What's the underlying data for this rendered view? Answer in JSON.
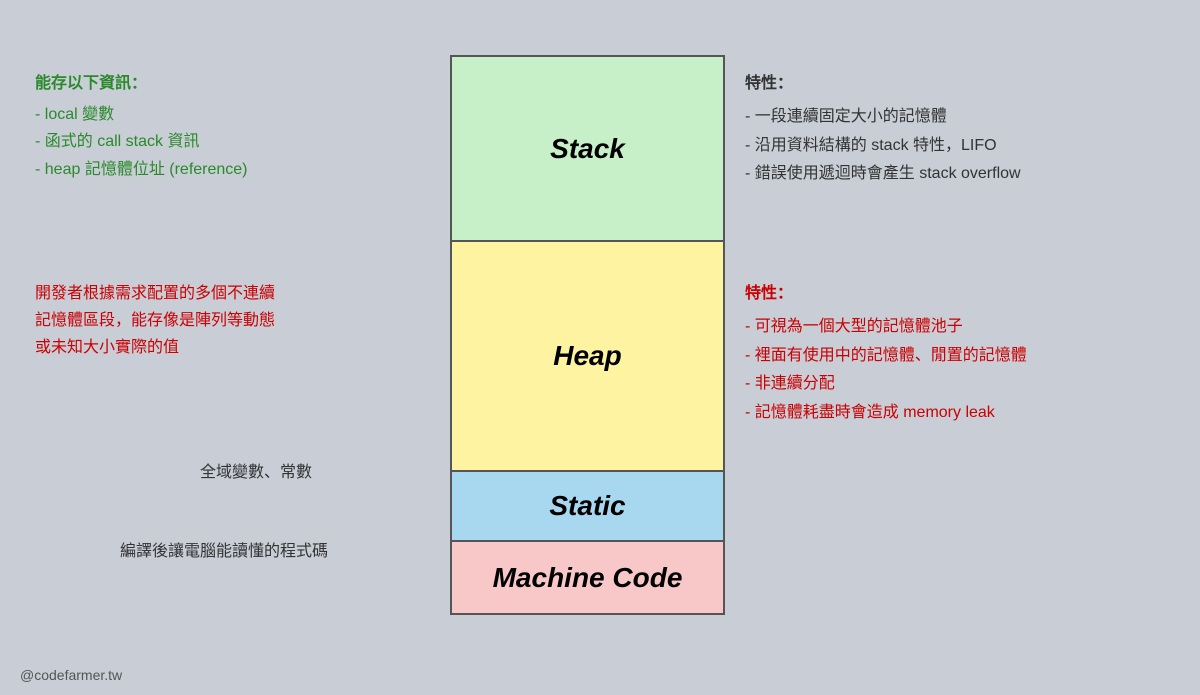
{
  "diagram": {
    "blocks": [
      {
        "id": "stack",
        "label": "Stack",
        "color_bg": "#c8f0c8"
      },
      {
        "id": "heap",
        "label": "Heap",
        "color_bg": "#fdf3a0"
      },
      {
        "id": "static",
        "label": "Static",
        "color_bg": "#a8d8f0"
      },
      {
        "id": "machine",
        "label": "Machine Code",
        "color_bg": "#f8c8c8"
      }
    ]
  },
  "left_stack": {
    "title": "能存以下資訊：",
    "lines": [
      "- local 變數",
      "- 函式的 call stack 資訊",
      "- heap 記憶體位址 (reference)"
    ]
  },
  "left_heap": {
    "lines": [
      "開發者根據需求配置的多個不連續",
      "記憶體區段，能存像是陣列等動態",
      "或未知大小實際的值"
    ]
  },
  "left_static": {
    "text": "全域變數、常數"
  },
  "left_machine": {
    "text": "編譯後讓電腦能讀懂的程式碼"
  },
  "right_stack": {
    "title": "特性：",
    "lines": [
      "- 一段連續固定大小的記憶體",
      "- 沿用資料結構的 stack 特性，LIFO",
      "- 錯誤使用遞迴時會產生 stack overflow"
    ]
  },
  "right_heap": {
    "title": "特性：",
    "lines": [
      "- 可視為一個大型的記憶體池子",
      "- 裡面有使用中的記憶體、閒置的記憶體",
      "- 非連續分配",
      "- 記憶體耗盡時會造成 memory leak"
    ]
  },
  "watermark": {
    "text": "@codefarmer.tw"
  }
}
